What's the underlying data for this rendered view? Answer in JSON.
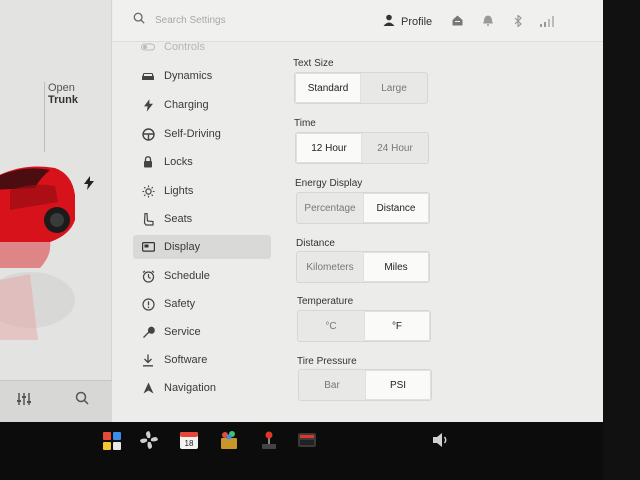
{
  "search": {
    "placeholder": "Search Settings"
  },
  "profile": {
    "label": "Profile"
  },
  "car": {
    "trunk_line1": "Open",
    "trunk_line2": "Trunk"
  },
  "menu": [
    {
      "label": "Controls",
      "icon": "toggle-icon",
      "state": "faded"
    },
    {
      "label": "Dynamics",
      "icon": "car-icon",
      "state": "normal"
    },
    {
      "label": "Charging",
      "icon": "bolt-icon",
      "state": "normal"
    },
    {
      "label": "Self-Driving",
      "icon": "steering-wheel-icon",
      "state": "normal"
    },
    {
      "label": "Locks",
      "icon": "lock-icon",
      "state": "normal"
    },
    {
      "label": "Lights",
      "icon": "sun-icon",
      "state": "normal"
    },
    {
      "label": "Seats",
      "icon": "seat-icon",
      "state": "normal"
    },
    {
      "label": "Display",
      "icon": "display-icon",
      "state": "active"
    },
    {
      "label": "Schedule",
      "icon": "clock-icon",
      "state": "normal"
    },
    {
      "label": "Safety",
      "icon": "safety-icon",
      "state": "normal"
    },
    {
      "label": "Service",
      "icon": "wrench-icon",
      "state": "normal"
    },
    {
      "label": "Software",
      "icon": "download-icon",
      "state": "normal"
    },
    {
      "label": "Navigation",
      "icon": "navigation-icon",
      "state": "normal"
    }
  ],
  "settings": {
    "text_size": {
      "label": "Text Size",
      "options": [
        "Standard",
        "Large"
      ],
      "selected": "Standard"
    },
    "time": {
      "label": "Time",
      "options": [
        "12 Hour",
        "24 Hour"
      ],
      "selected": "12 Hour"
    },
    "energy_display": {
      "label": "Energy Display",
      "options": [
        "Percentage",
        "Distance"
      ],
      "selected": "Distance"
    },
    "distance": {
      "label": "Distance",
      "options": [
        "Kilometers",
        "Miles"
      ],
      "selected": "Miles"
    },
    "temperature": {
      "label": "Temperature",
      "options": [
        "°C",
        "°F"
      ],
      "selected": "°F"
    },
    "tire_pressure": {
      "label": "Tire Pressure",
      "options": [
        "Bar",
        "PSI"
      ],
      "selected": "PSI"
    }
  },
  "dock": {
    "calendar_day": "18"
  },
  "colors": {
    "car_red": "#d8121b",
    "selected_row": "#d9dad8",
    "background": "#ecedeb"
  }
}
